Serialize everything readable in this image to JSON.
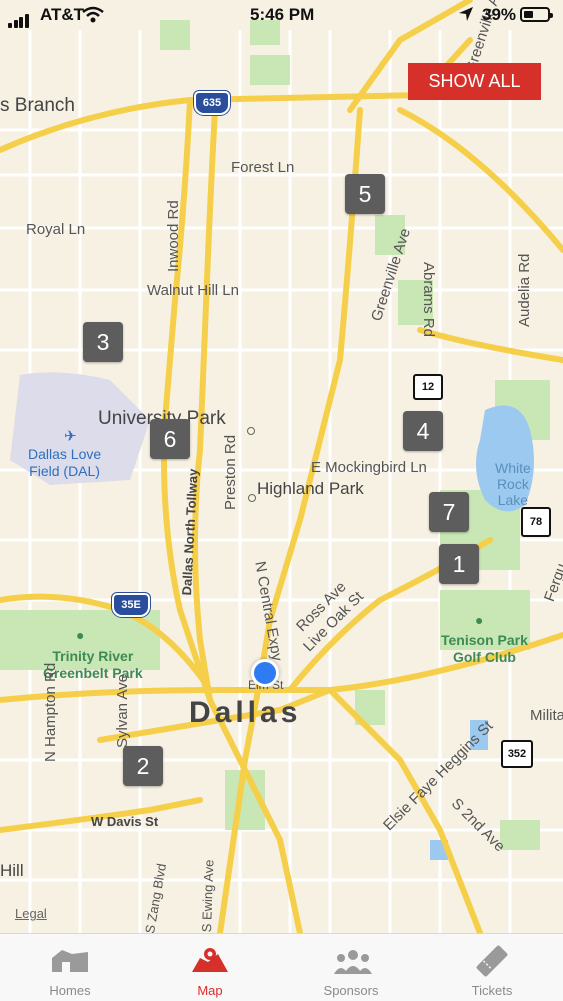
{
  "status_bar": {
    "carrier": "AT&T",
    "time": "5:46 PM",
    "battery_percent": "39%",
    "battery_level": 0.39
  },
  "map": {
    "show_all_label": "SHOW ALL",
    "legal_label": "Legal",
    "labels": {
      "farmers_branch": "s Branch",
      "forest_ln": "Forest Ln",
      "royal_ln": "Royal Ln",
      "inwood_rd": "Inwood Rd",
      "walnut_hill_ln": "Walnut Hill Ln",
      "greenville_ave_north": "Greenville Ave",
      "greenville_ave_top": "Greenville Ave",
      "abrams_rd": "Abrams Rd",
      "audelia_rd": "Audelia Rd",
      "university_park": "University Park",
      "dallas_love_field": "Dallas Love\nField (DAL)",
      "preston_rd": "Preston Rd",
      "e_mockingbird_ln": "E Mockingbird Ln",
      "highland_park": "Highland Park",
      "white_rock_lake": "White\nRock\nLake",
      "dallas_north_tollway": "Dallas North Tollway",
      "n_central_expy": "N Central Expy",
      "ross_ave": "Ross Ave",
      "live_oak_st": "Live Oak St",
      "ferguson": "Fergu",
      "trinity_river_greenbelt_park": "Trinity River\nGreenbelt Park",
      "tenison_park_golf_club": "Tenison Park\nGolf Club",
      "elm_st": "Elm St",
      "dallas": "Dallas",
      "n_hampton_rd": "N Hampton Rd",
      "sylvan_ave": "Sylvan Ave",
      "military": "Milita",
      "w_davis_st": "W Davis St",
      "elsie_faye_heggins_st": "Elsie Faye Heggins St",
      "s_2nd_ave": "S 2nd Ave",
      "hill": "Hill",
      "s_zang_blvd": "S Zang Blvd",
      "s_ewing_ave": "S Ewing Ave"
    },
    "shields": {
      "i635": "635",
      "i35e": "35E",
      "sh12": "12",
      "sh78": "78",
      "sh352": "352"
    },
    "markers": [
      "1",
      "2",
      "3",
      "4",
      "5",
      "6",
      "7"
    ]
  },
  "tabbar": {
    "tabs": [
      {
        "label": "Homes",
        "icon": "homes-icon"
      },
      {
        "label": "Map",
        "icon": "map-icon",
        "active": true
      },
      {
        "label": "Sponsors",
        "icon": "sponsors-icon"
      },
      {
        "label": "Tickets",
        "icon": "tickets-icon"
      }
    ]
  },
  "colors": {
    "accent": "#d6302b",
    "marker": "#5d5d5d",
    "user_dot": "#2f7bf2",
    "highway": "#f6cf4a"
  }
}
